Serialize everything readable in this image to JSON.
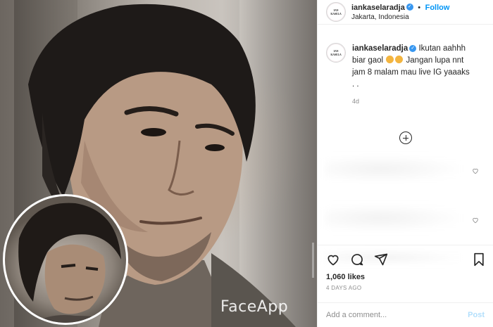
{
  "post": {
    "watermark": "FaceApp"
  },
  "header": {
    "avatar_text": "IAN KASELA",
    "username": "iankaselaradja",
    "verified": "✓",
    "separator": "•",
    "follow_label": "Follow",
    "location": "Jakarta, Indonesia"
  },
  "caption": {
    "username": "iankaselaradja",
    "text_part1": "Ikutan aahhh biar gaol",
    "text_part2": "Jangan lupa nnt jam 8 malam mau live IG yaaaks . .",
    "time_ago": "4d"
  },
  "actions": {
    "like_icon": "heart-icon",
    "comment_icon": "comment-icon",
    "share_icon": "share-icon",
    "save_icon": "bookmark-icon"
  },
  "likes": {
    "count_text": "1,060 likes"
  },
  "date": {
    "text": "4 DAYS AGO"
  },
  "comment_box": {
    "placeholder": "Add a comment...",
    "post_label": "Post"
  },
  "colors": {
    "accent": "#0095f6",
    "verified": "#3897f0",
    "post_disabled": "#b2dffc"
  }
}
